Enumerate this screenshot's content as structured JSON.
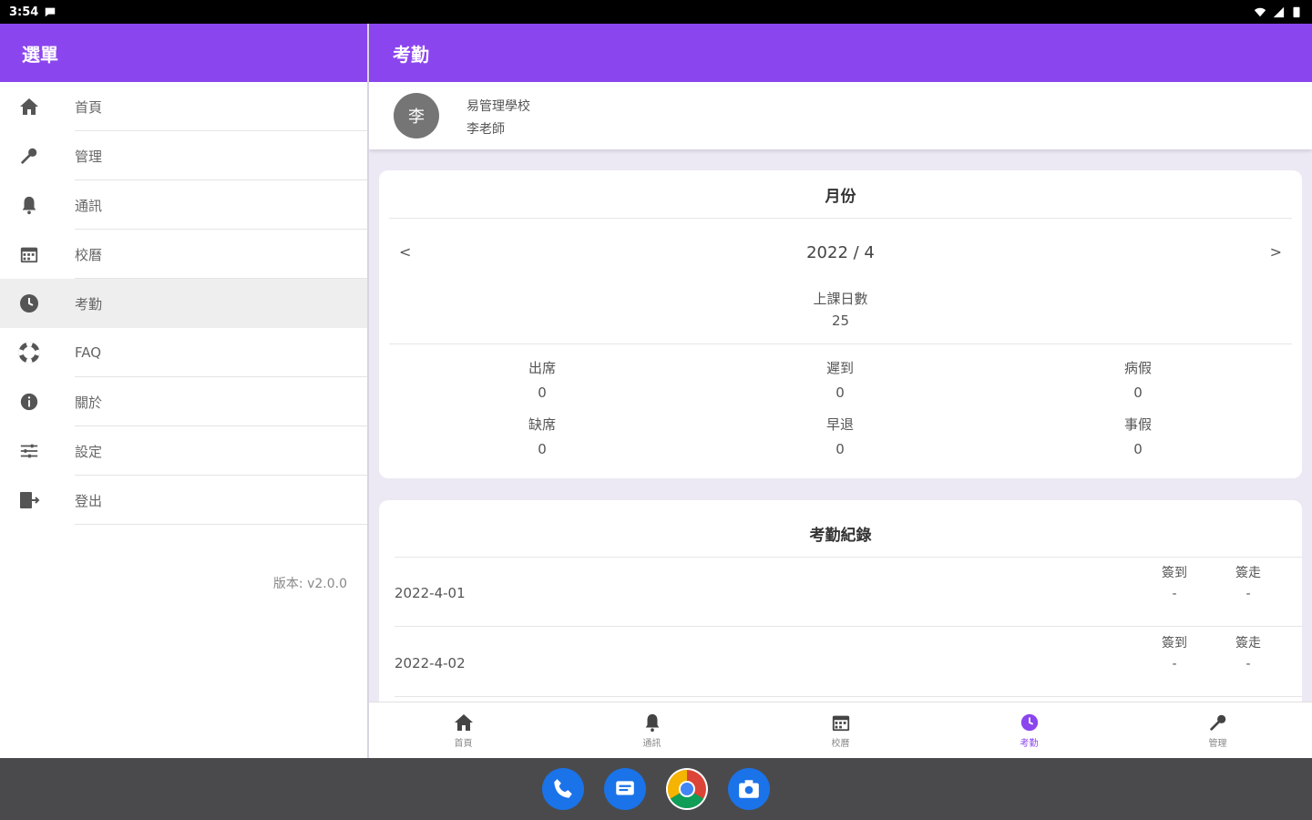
{
  "status_bar": {
    "time": "3:54"
  },
  "drawer": {
    "title": "選單",
    "items": [
      {
        "label": "首頁",
        "icon": "home-icon"
      },
      {
        "label": "管理",
        "icon": "wrench-icon"
      },
      {
        "label": "通訊",
        "icon": "bell-icon"
      },
      {
        "label": "校曆",
        "icon": "calendar-icon"
      },
      {
        "label": "考勤",
        "icon": "clock-icon",
        "active": true
      },
      {
        "label": "FAQ",
        "icon": "lifebuoy-icon"
      },
      {
        "label": "關於",
        "icon": "info-icon"
      },
      {
        "label": "設定",
        "icon": "sliders-icon"
      },
      {
        "label": "登出",
        "icon": "logout-icon"
      }
    ],
    "version": "版本: v2.0.0"
  },
  "main": {
    "title": "考勤",
    "profile": {
      "avatar_text": "李",
      "school": "易管理學校",
      "teacher": "李老師"
    },
    "month_card": {
      "title": "月份",
      "prev": "<",
      "next": ">",
      "month": "2022 / 4",
      "school_days_label": "上課日數",
      "school_days_value": "25",
      "stats": [
        {
          "label": "出席",
          "value": "0"
        },
        {
          "label": "遲到",
          "value": "0"
        },
        {
          "label": "病假",
          "value": "0"
        },
        {
          "label": "缺席",
          "value": "0"
        },
        {
          "label": "早退",
          "value": "0"
        },
        {
          "label": "事假",
          "value": "0"
        }
      ]
    },
    "records_card": {
      "title": "考勤紀錄",
      "rows": [
        {
          "date": "2022-4-01",
          "sign_in_label": "簽到",
          "sign_in": "-",
          "sign_out_label": "簽走",
          "sign_out": "-"
        },
        {
          "date": "2022-4-02",
          "sign_in_label": "簽到",
          "sign_in": "-",
          "sign_out_label": "簽走",
          "sign_out": "-"
        }
      ]
    }
  },
  "bottom_nav": [
    {
      "label": "首頁",
      "icon": "home-icon"
    },
    {
      "label": "通訊",
      "icon": "bell-icon"
    },
    {
      "label": "校曆",
      "icon": "calendar-icon"
    },
    {
      "label": "考勤",
      "icon": "clock-icon",
      "active": true
    },
    {
      "label": "管理",
      "icon": "wrench-icon"
    }
  ],
  "dock": [
    {
      "name": "phone",
      "icon": "phone-icon",
      "color": "#1a73e8"
    },
    {
      "name": "messages",
      "icon": "message-icon",
      "color": "#1a73e8"
    },
    {
      "name": "chrome",
      "icon": "chrome-icon",
      "color": "#ffffff"
    },
    {
      "name": "camera",
      "icon": "camera-icon",
      "color": "#1a73e8"
    }
  ],
  "colors": {
    "primary": "#8b45ee",
    "background": "#ece9f4"
  }
}
